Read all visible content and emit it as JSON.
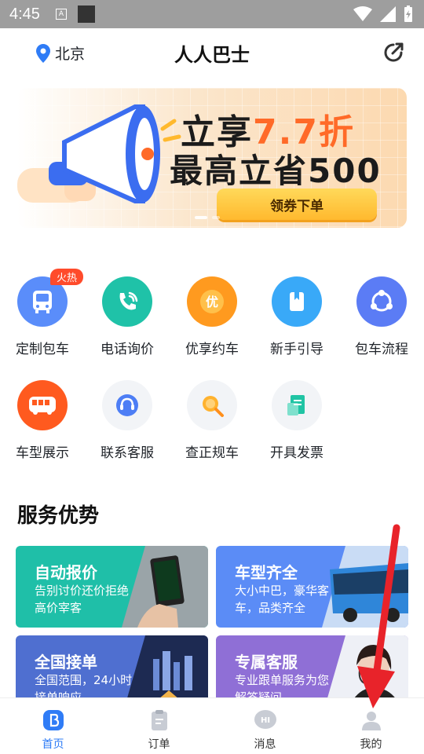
{
  "status_bar": {
    "time": "4:45",
    "a_icon": "A"
  },
  "header": {
    "location": "北京",
    "title": "人人巴士"
  },
  "banner": {
    "line1_prefix": "立享",
    "line1_highlight": "7.7折",
    "line2": "最高立省500",
    "button_label": "领券下单"
  },
  "quick_actions": [
    {
      "label": "定制包车",
      "icon": "bus-icon",
      "color": "#5a8dfa",
      "badge": "火热"
    },
    {
      "label": "电话询价",
      "icon": "phone-icon",
      "color": "#1fc2a8"
    },
    {
      "label": "优享约车",
      "icon": "coupon-icon",
      "color": "#ff9a1f"
    },
    {
      "label": "新手引导",
      "icon": "guide-icon",
      "color": "#39a9f8"
    },
    {
      "label": "包车流程",
      "icon": "flow-icon",
      "color": "#5b7cf5"
    },
    {
      "label": "车型展示",
      "icon": "coach-icon",
      "color": "#ff5a1f"
    },
    {
      "label": "联系客服",
      "icon": "service-icon",
      "color": "#4d7ef5"
    },
    {
      "label": "查正规车",
      "icon": "search-icon",
      "color": "#ff9e1b"
    },
    {
      "label": "开具发票",
      "icon": "invoice-icon",
      "color": "#20c4a4"
    }
  ],
  "section": {
    "title": "服务优势"
  },
  "cards": [
    {
      "title": "自动报价",
      "subtitle": "告别讨价还价拒绝高价宰客",
      "color": "#1fbfa8"
    },
    {
      "title": "车型齐全",
      "subtitle": "大小中巴，豪华客车，品类齐全",
      "color": "#5b8cf6"
    },
    {
      "title": "全国接单",
      "subtitle": "全国范围，24小时接单响应",
      "color": "#4f6fd0"
    },
    {
      "title": "专属客服",
      "subtitle": "专业跟单服务为您解答疑问",
      "color": "#8f6fd6"
    }
  ],
  "tabbar": {
    "items": [
      {
        "label": "首页",
        "icon": "home-icon",
        "active": true
      },
      {
        "label": "订单",
        "icon": "order-icon",
        "active": false
      },
      {
        "label": "消息",
        "icon": "message-icon",
        "active": false
      },
      {
        "label": "我的",
        "icon": "profile-icon",
        "active": false
      }
    ]
  },
  "colors": {
    "accent": "#2f7cf6",
    "annotation_arrow": "#e8232a"
  }
}
